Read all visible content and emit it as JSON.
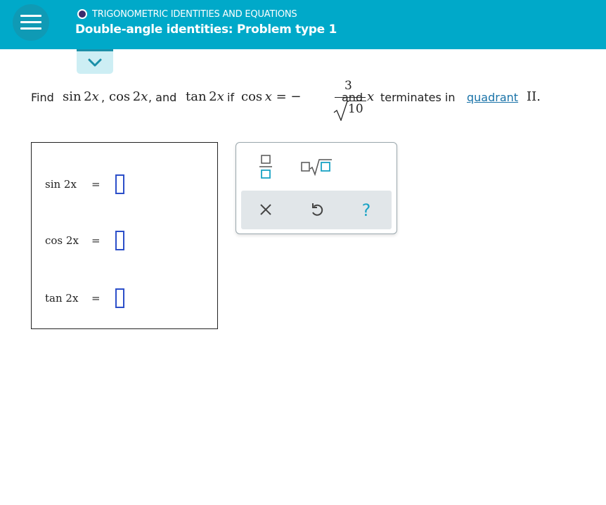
{
  "header": {
    "topic": "TRIGONOMETRIC IDENTITIES AND EQUATIONS",
    "subtitle": "Double-angle identities: Problem type 1",
    "menu_icon": "hamburger-menu-icon",
    "expand_icon": "chevron-down-icon"
  },
  "problem": {
    "find": "Find",
    "sin2x": "sin 2x",
    "comma1": ",",
    "cos2x": "cos 2x",
    "and1": ", and",
    "tan2x": "tan 2x",
    "if": "if",
    "cosx": "cos x = −",
    "numerator": "3",
    "denominator": "10",
    "and2": "and",
    "x": "x",
    "terminates": "terminates in",
    "link": "quadrant",
    "quadrant_num": "II."
  },
  "answers": [
    {
      "label": "sin 2x",
      "eq": "=",
      "value": ""
    },
    {
      "label": "cos 2x",
      "eq": "=",
      "value": ""
    },
    {
      "label": "tan 2x",
      "eq": "=",
      "value": ""
    }
  ],
  "keypad": {
    "keys": [
      "fraction-icon",
      "sqrt-icon"
    ],
    "actions": [
      "clear-icon",
      "undo-icon",
      "help-icon"
    ],
    "help_label": "?"
  },
  "colors": {
    "header_bg": "#00a9c9",
    "accent": "#1aa3c4",
    "input_border": "#2c4fc9",
    "link": "#1a73a8"
  }
}
